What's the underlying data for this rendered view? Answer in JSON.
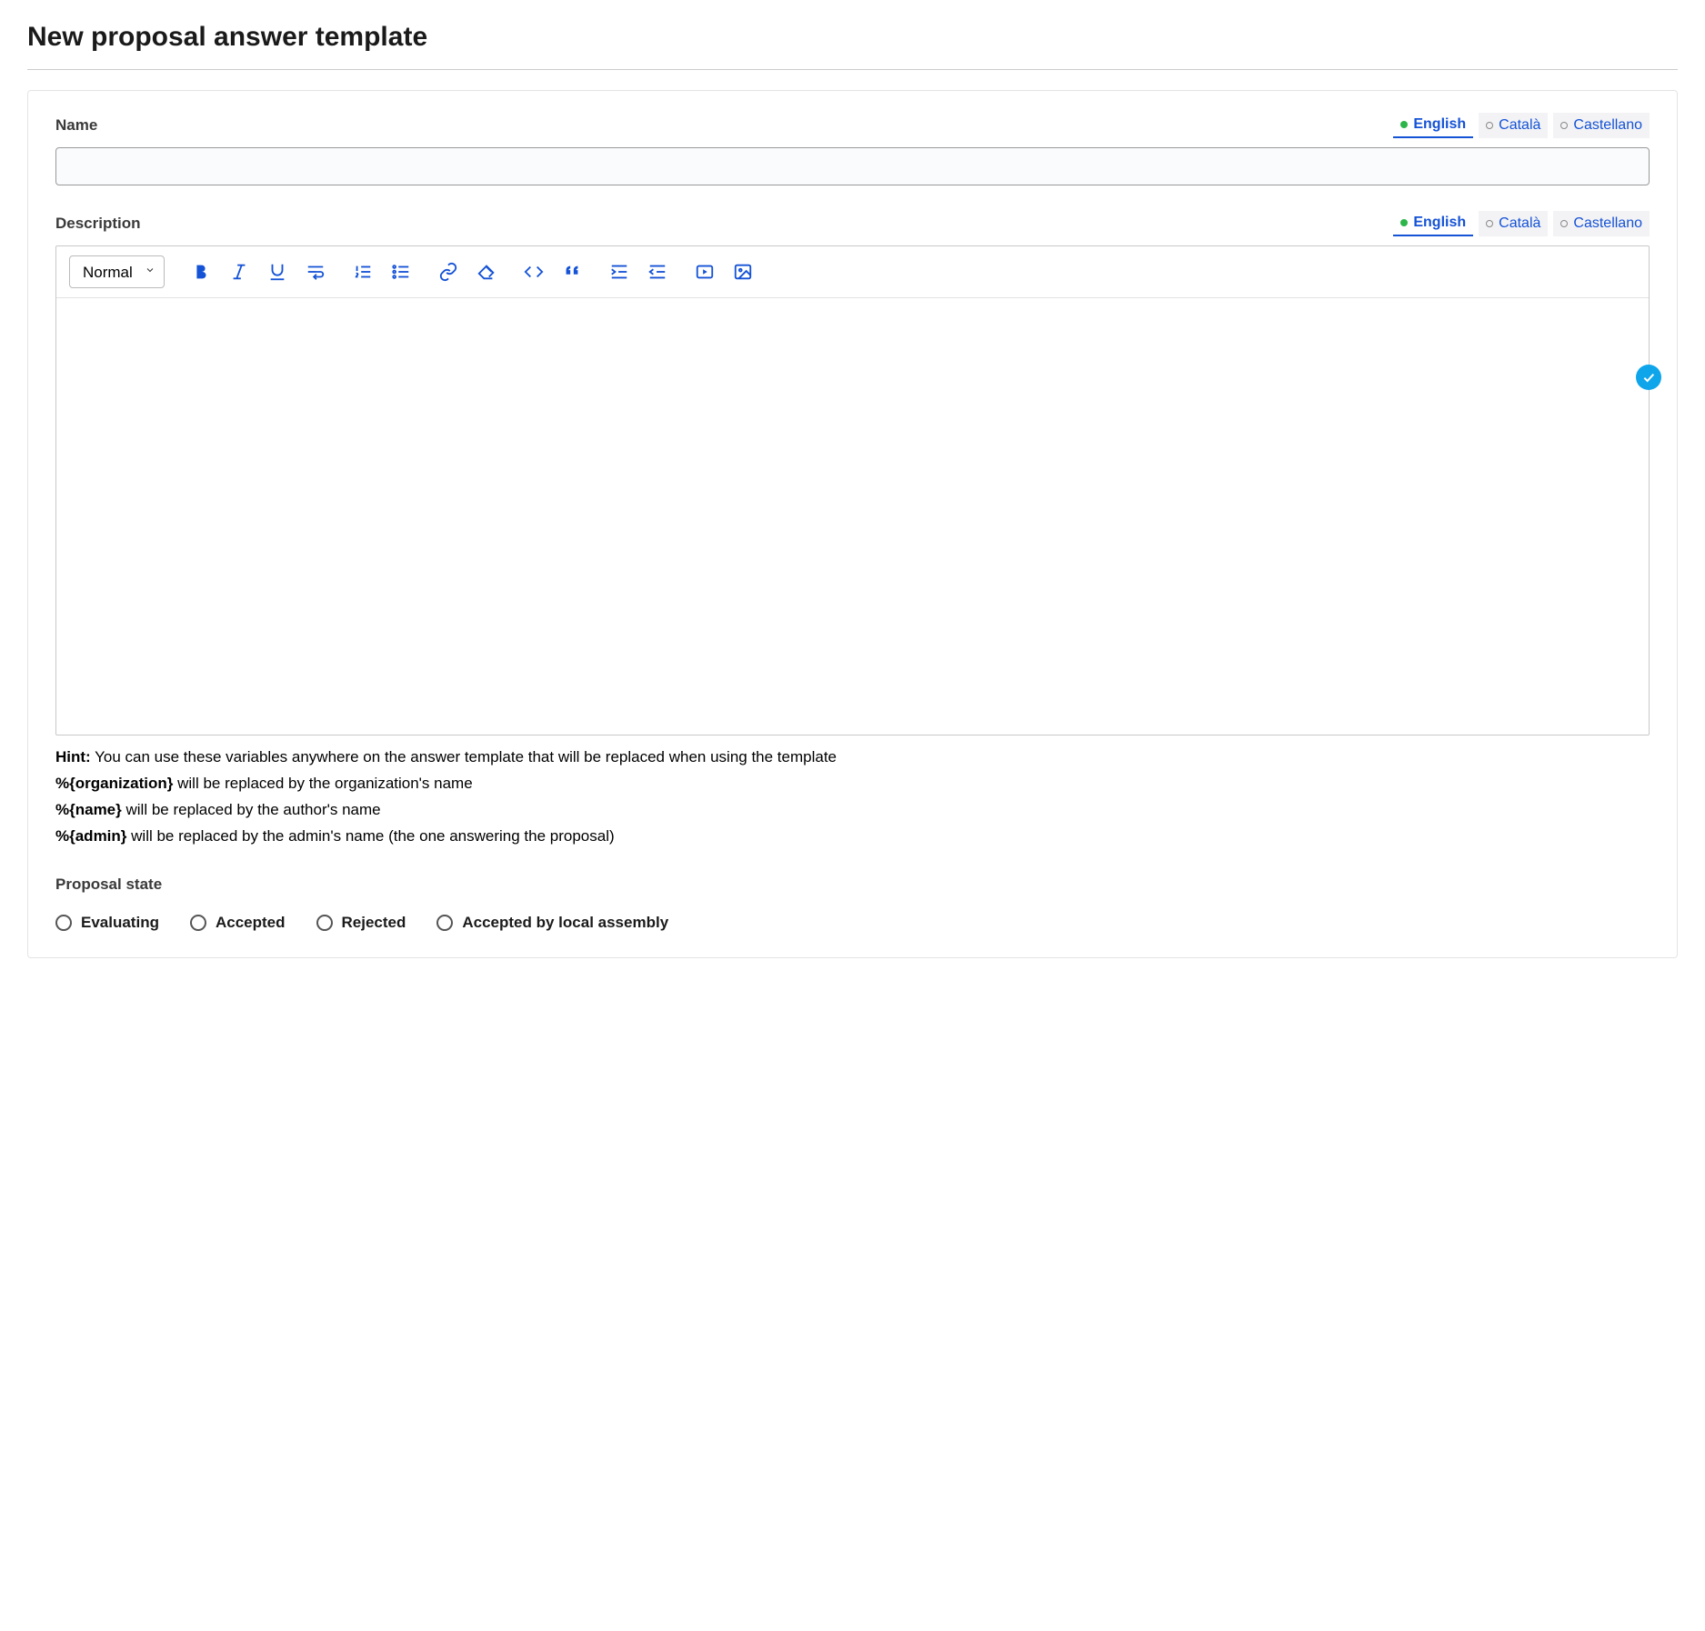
{
  "page": {
    "title": "New proposal answer template"
  },
  "languages": [
    {
      "label": "English",
      "active": true
    },
    {
      "label": "Català",
      "active": false
    },
    {
      "label": "Castellano",
      "active": false
    }
  ],
  "fields": {
    "name": {
      "label": "Name",
      "value": ""
    },
    "description": {
      "label": "Description"
    }
  },
  "editor": {
    "format_selected": "Normal"
  },
  "hint": {
    "prefix": "Hint:",
    "intro": " You can use these variables anywhere on the answer template that will be replaced when using the template",
    "vars": [
      {
        "token": "%{organization}",
        "text": " will be replaced by the organization's name"
      },
      {
        "token": "%{name}",
        "text": " will be replaced by the author's name"
      },
      {
        "token": "%{admin}",
        "text": " will be replaced by the admin's name (the one answering the proposal)"
      }
    ]
  },
  "state": {
    "label": "Proposal state",
    "options": [
      {
        "label": "Evaluating"
      },
      {
        "label": "Accepted"
      },
      {
        "label": "Rejected"
      },
      {
        "label": "Accepted by local assembly"
      }
    ]
  }
}
